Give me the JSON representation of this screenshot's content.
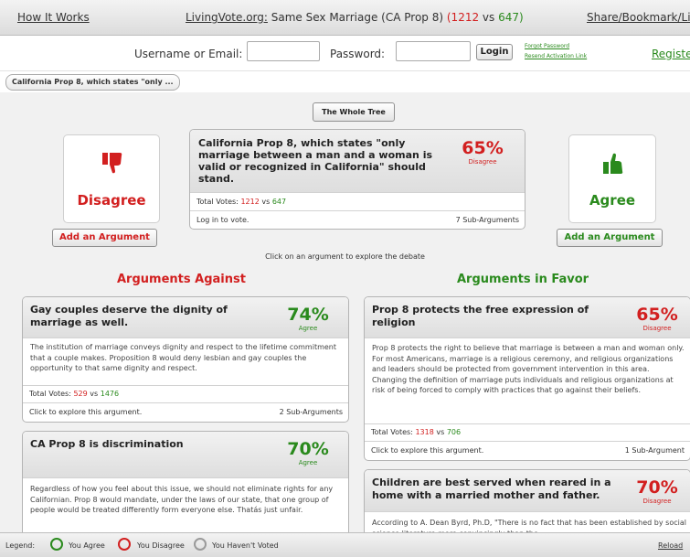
{
  "topnav": {
    "how_it_works": "How It Works",
    "site": "LivingVote.org:",
    "topic": " Same Sex Marriage (CA Prop 8) ",
    "votes_for": "(1212",
    "vs": " vs ",
    "votes_against": "647)",
    "share": "Share/Bookmark/Lin"
  },
  "login": {
    "username_label": "Username or Email:",
    "password_label": "Password:",
    "login_button": "Login",
    "forgot_password": "Forgot Password",
    "resend_activation": "Resend Activation Link",
    "register": "Registe"
  },
  "breadcrumb": "California Prop 8, which states \"only ...",
  "whole_tree_button": "The Whole Tree",
  "disagree": {
    "label": "Disagree",
    "add_argument": "Add an Argument"
  },
  "agree": {
    "label": "Agree",
    "add_argument": "Add an Argument"
  },
  "proposition": {
    "text": "California Prop 8, which states \"only marriage between a man and a woman is valid or recognized in California\" should stand.",
    "percent": "65%",
    "percent_label": "Disagree",
    "total_votes_label": "Total Votes:",
    "votes_a": "1212",
    "vs": "vs",
    "votes_b": "647",
    "login_prompt": "Log in to vote.",
    "sub_arguments": "7 Sub-Arguments"
  },
  "hint": "Click on an argument to explore the debate",
  "arguments_against": {
    "title": "Arguments Against",
    "items": [
      {
        "title": "Gay couples deserve the dignity of marriage as well.",
        "percent": "74%",
        "percent_label": "Agree",
        "body": "The institution of marriage conveys dignity and respect to the lifetime commitment that a couple makes. Proposition 8 would deny lesbian and gay couples the opportunity to that same dignity and respect.",
        "total_votes_label": "Total Votes:",
        "votes_a": "529",
        "vs": "vs",
        "votes_b": "1476",
        "explore": "Click to explore this argument.",
        "sub_arguments": "2 Sub-Arguments"
      },
      {
        "title": "CA Prop 8 is discrimination",
        "percent": "70%",
        "percent_label": "Agree",
        "body": "Regardless of how you feel about this issue, we should not eliminate rights for any Californian. Prop 8 would mandate, under the laws of our state, that one group of people would be treated differently form everyone else. Thatás just unfair."
      }
    ]
  },
  "arguments_favor": {
    "title": "Arguments in Favor",
    "items": [
      {
        "title": "Prop 8 protects the free expression of religion",
        "percent": "65%",
        "percent_label": "Disagree",
        "body": "Prop 8 protects the right to believe that marriage is between a man and woman only. For most Americans, marriage is a religious ceremony, and religious organizations and leaders should be protected from government intervention in this area. Changing the definition of marriage puts individuals and religious organizations at risk of being forced to comply with practices that go against their beliefs.",
        "total_votes_label": "Total Votes:",
        "votes_a": "1318",
        "vs": "vs",
        "votes_b": "706",
        "explore": "Click to explore this argument.",
        "sub_arguments": "1 Sub-Argument"
      },
      {
        "title": "Children are best served when reared in a home with a married mother and father.",
        "percent": "70%",
        "percent_label": "Disagree",
        "body": "According to A. Dean Byrd, Ph.D, \"There is no fact that has been established by social science literature more convincingly than the"
      }
    ]
  },
  "legend": {
    "label": "Legend:",
    "you_agree": "You Agree",
    "you_disagree": "You Disagree",
    "not_voted": "You Haven't Voted",
    "reload": "Reload",
    "colors": {
      "agree": "#2a8a1d",
      "disagree": "#d21f1f",
      "not_voted": "#9a9a9a"
    }
  },
  "colors": {
    "disagree_red": "#d21f1f",
    "agree_green": "#2a8a1d"
  },
  "icons": {
    "disagree": "thumbs-down-icon",
    "agree": "thumbs-up-icon"
  }
}
